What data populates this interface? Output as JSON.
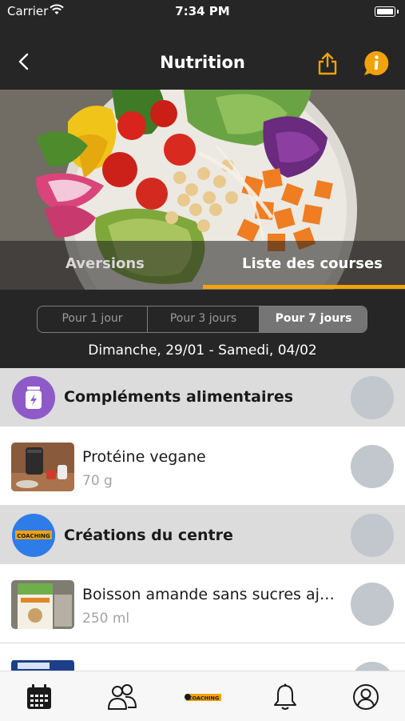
{
  "status_bar": {
    "carrier": "Carrier",
    "time": "7:34 PM"
  },
  "nav": {
    "title": "Nutrition",
    "back_icon": "chevron-left-icon",
    "share_icon": "share-icon",
    "info_icon": "info-bubble-icon",
    "accent": "#f2a20c"
  },
  "hero": {
    "tabs": [
      {
        "label": "Aversions",
        "selected": false
      },
      {
        "label": "Liste des courses",
        "selected": true
      }
    ]
  },
  "period": {
    "options": [
      "Pour 1 jour",
      "Pour 3 jours",
      "Pour 7 jours"
    ],
    "selected": "Pour 7 jours",
    "date_range": "Dimanche, 29/01 - Samedi, 04/02"
  },
  "sections": [
    {
      "title": "Compléments alimentaires",
      "icon": "supplement-jar-icon",
      "icon_color": "#8e5ac8",
      "items": [
        {
          "name": "Protéine vegane",
          "qty": "70 g"
        }
      ]
    },
    {
      "title": "Créations du centre",
      "icon": "coaching-logo",
      "logo_text": "COACHING",
      "icon_color": "#2e7ce8",
      "items": [
        {
          "name": "Boisson amande sans sucres ajo…",
          "qty": "250 ml"
        }
      ]
    }
  ],
  "tab_bar": {
    "items": [
      "calendar-icon",
      "group-icon",
      "coaching-logo",
      "bell-icon",
      "profile-icon"
    ],
    "logo_text": "COACHING"
  }
}
